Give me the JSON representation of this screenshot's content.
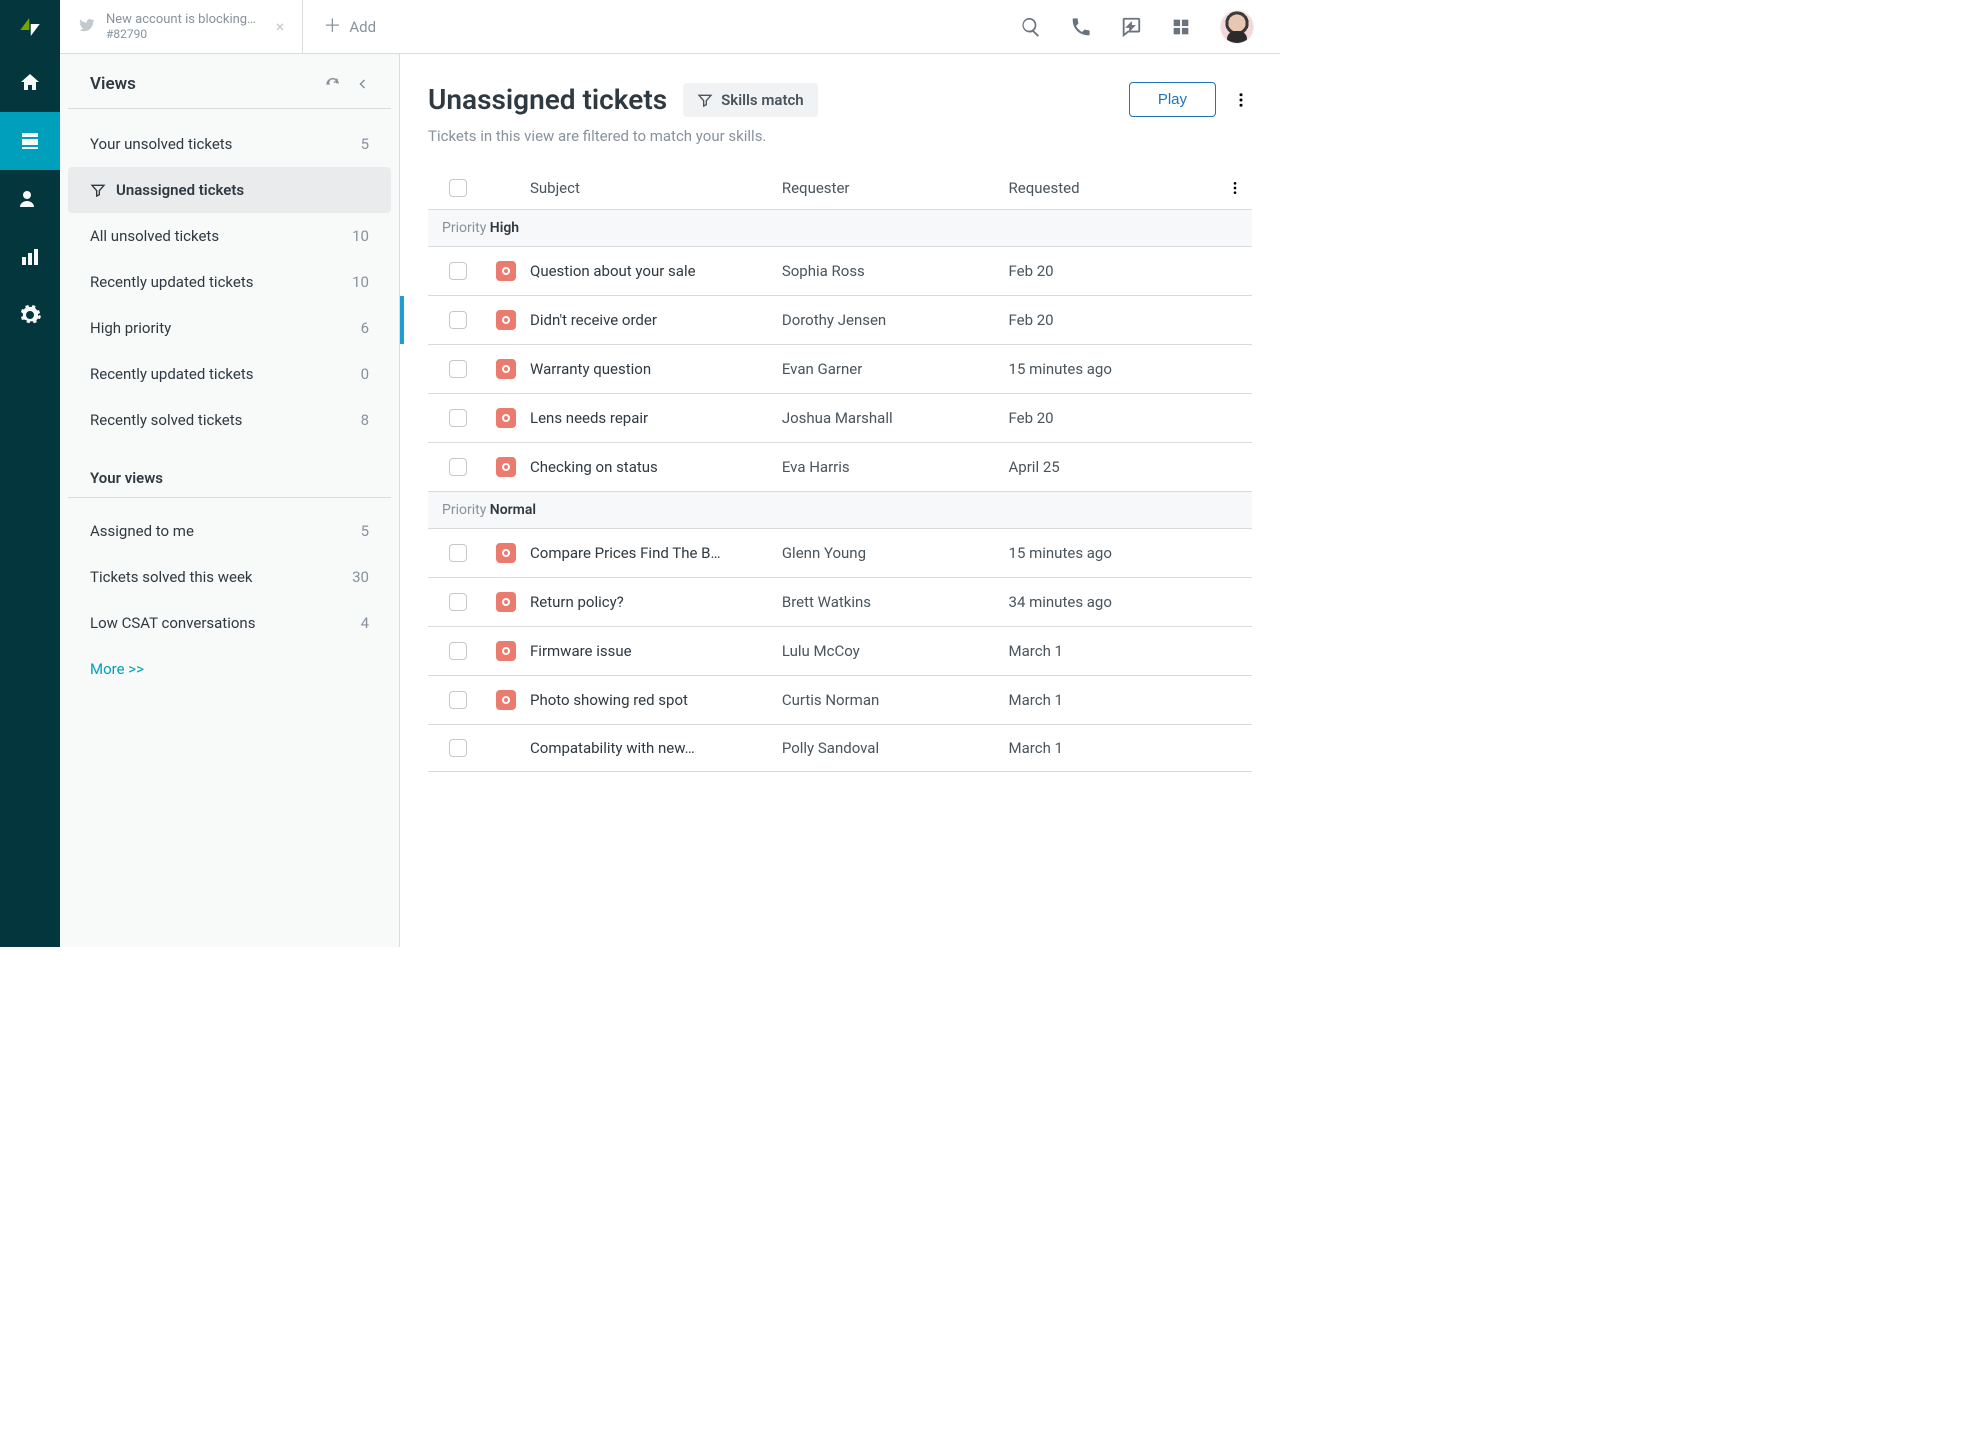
{
  "tab": {
    "title": "New account is blocking…",
    "sub": "#82790"
  },
  "add_label": "Add",
  "sidebar": {
    "title": "Views",
    "system": [
      {
        "label": "Your unsolved tickets",
        "count": "5",
        "active": false,
        "filter": false
      },
      {
        "label": "Unassigned tickets",
        "count": "",
        "active": true,
        "filter": true
      },
      {
        "label": "All unsolved tickets",
        "count": "10",
        "active": false,
        "filter": false
      },
      {
        "label": "Recently updated tickets",
        "count": "10",
        "active": false,
        "filter": false
      },
      {
        "label": "High priority",
        "count": "6",
        "active": false,
        "filter": false
      },
      {
        "label": "Recently updated tickets",
        "count": "0",
        "active": false,
        "filter": false
      },
      {
        "label": "Recently solved tickets",
        "count": "8",
        "active": false,
        "filter": false
      }
    ],
    "your_section": "Your views",
    "your": [
      {
        "label": "Assigned to me",
        "count": "5"
      },
      {
        "label": "Tickets solved this week",
        "count": "30"
      },
      {
        "label": "Low CSAT conversations",
        "count": "4"
      }
    ],
    "more": "More >>"
  },
  "header": {
    "title": "Unassigned tickets",
    "chip": "Skills match",
    "play": "Play",
    "subtitle": "Tickets in this view are filtered to match your skills."
  },
  "columns": {
    "subject": "Subject",
    "requester": "Requester",
    "requested": "Requested"
  },
  "groups": [
    {
      "label": "Priority",
      "value": "High",
      "rows": [
        {
          "subject": "Question about your sale",
          "requester": "Sophia Ross",
          "requested": "Feb 20",
          "badge": true,
          "selected": false
        },
        {
          "subject": "Didn't receive order",
          "requester": "Dorothy Jensen",
          "requested": "Feb 20",
          "badge": true,
          "selected": true
        },
        {
          "subject": "Warranty question",
          "requester": "Evan Garner",
          "requested": "15 minutes ago",
          "badge": true,
          "selected": false
        },
        {
          "subject": "Lens needs repair",
          "requester": "Joshua Marshall",
          "requested": "Feb 20",
          "badge": true,
          "selected": false
        },
        {
          "subject": "Checking on status",
          "requester": "Eva Harris",
          "requested": "April 25",
          "badge": true,
          "selected": false
        }
      ]
    },
    {
      "label": "Priority",
      "value": "Normal",
      "rows": [
        {
          "subject": "Compare Prices Find The B…",
          "requester": "Glenn Young",
          "requested": "15 minutes ago",
          "badge": true,
          "selected": false
        },
        {
          "subject": "Return policy?",
          "requester": "Brett Watkins",
          "requested": "34 minutes ago",
          "badge": true,
          "selected": false
        },
        {
          "subject": "Firmware issue",
          "requester": "Lulu McCoy",
          "requested": "March 1",
          "badge": true,
          "selected": false
        },
        {
          "subject": "Photo showing red spot",
          "requester": "Curtis Norman",
          "requested": "March 1",
          "badge": true,
          "selected": false
        },
        {
          "subject": "Compatability with new…",
          "requester": "Polly Sandoval",
          "requested": "March 1",
          "badge": false,
          "selected": false
        }
      ]
    }
  ]
}
